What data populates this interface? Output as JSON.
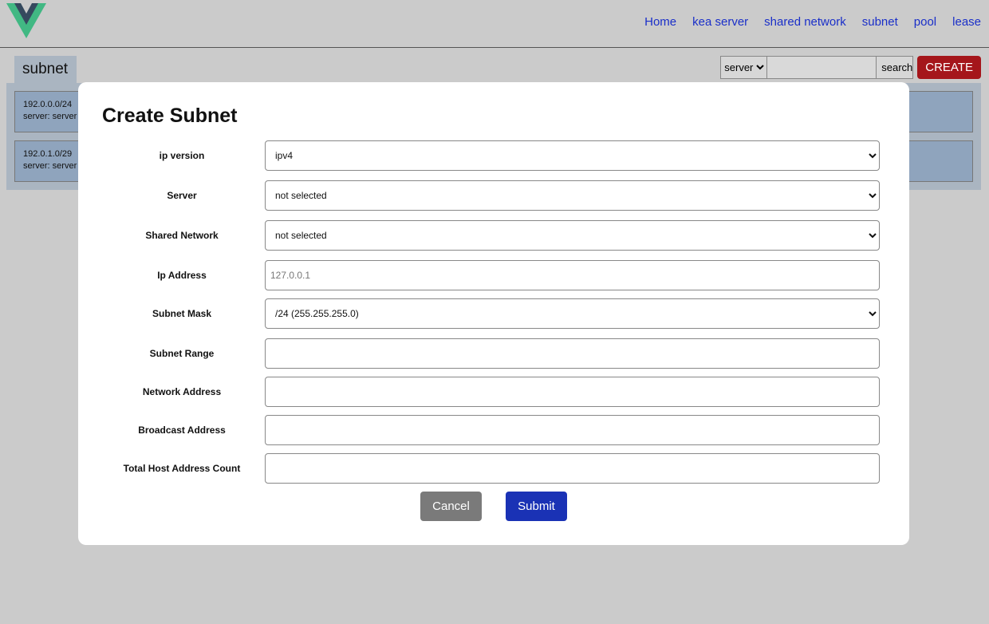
{
  "nav": {
    "items": [
      "Home",
      "kea server",
      "shared network",
      "subnet",
      "pool",
      "lease"
    ]
  },
  "page": {
    "title": "subnet"
  },
  "toolbar": {
    "search_scope": "server",
    "search_label": "search",
    "create_label": "CREATE"
  },
  "list": {
    "items": [
      {
        "subnet": "192.0.0.0/24",
        "server": "server: server"
      },
      {
        "subnet": "192.0.1.0/29",
        "server": "server: server"
      }
    ]
  },
  "modal": {
    "title": "Create Subnet",
    "fields": {
      "ip_version": {
        "label": "ip version",
        "value": "ipv4"
      },
      "server": {
        "label": "Server",
        "value": "not selected"
      },
      "shared_network": {
        "label": "Shared Network",
        "value": "not selected"
      },
      "ip_address": {
        "label": "Ip Address",
        "placeholder": "127.0.0.1"
      },
      "subnet_mask": {
        "label": "Subnet Mask",
        "value": "/24 (255.255.255.0)"
      },
      "subnet_range": {
        "label": "Subnet Range",
        "value": ""
      },
      "network_address": {
        "label": "Network Address",
        "value": ""
      },
      "broadcast_address": {
        "label": "Broadcast Address",
        "value": ""
      },
      "total_host_count": {
        "label": "Total Host Address Count",
        "value": ""
      }
    },
    "cancel_label": "Cancel",
    "submit_label": "Submit"
  },
  "colors": {
    "background": "#cbcbcb",
    "nav_link": "#1a2fc9",
    "create_button": "#a5161b",
    "submit_button": "#1a32b5",
    "cancel_button": "#7a7a7a",
    "logo_green": "#41b883",
    "logo_dark": "#35495e"
  }
}
